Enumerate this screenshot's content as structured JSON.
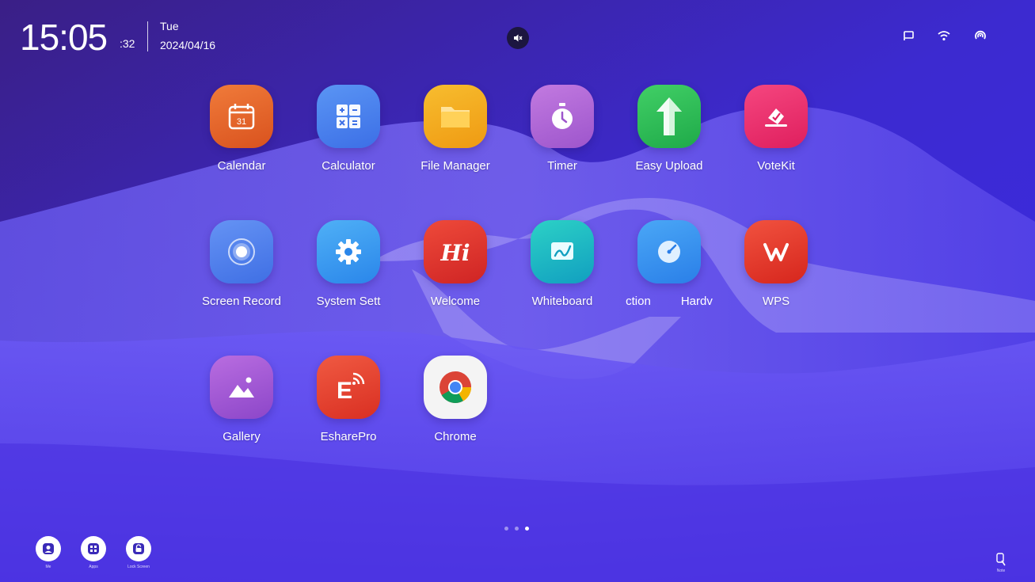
{
  "status_bar": {
    "time": "15:05",
    "seconds": ":32",
    "day": "Tue",
    "date": "2024/04/16",
    "icons": [
      "cast-icon",
      "wifi-icon",
      "hotspot-icon"
    ],
    "mute_icon": "volume-mute-icon"
  },
  "apps": [
    {
      "label": "Calendar",
      "icon": "calendar-icon",
      "color": "#e4642a"
    },
    {
      "label": "Calculator",
      "icon": "calculator-icon",
      "color": "#4a86f0"
    },
    {
      "label": "File Manager",
      "icon": "folder-icon",
      "color": "#f2a51c"
    },
    {
      "label": "Timer",
      "icon": "stopwatch-icon",
      "color": "#b46ad8"
    },
    {
      "label": "Easy Upload",
      "icon": "upload-arrow-icon",
      "color": "#2ebd5a"
    },
    {
      "label": "VoteKit",
      "icon": "vote-icon",
      "color": "#ec2f6e"
    },
    {
      "label": "Screen Record",
      "icon": "record-icon",
      "color": "#4f7ff0"
    },
    {
      "label": "System Sett",
      "icon": "gear-icon",
      "color": "#3b9cf0"
    },
    {
      "label": "Welcome",
      "icon": "hi-icon",
      "color": "#e2352f"
    },
    {
      "label": "Whiteboard",
      "icon": "whiteboard-icon",
      "color": "#14b7c4"
    },
    {
      "label": "ction",
      "label2": "Hardv",
      "icon": "gauge-icon",
      "color": "#2f8fee"
    },
    {
      "label": "WPS",
      "icon": "wps-icon",
      "color": "#e4382e"
    },
    {
      "label": "Gallery",
      "icon": "gallery-icon",
      "color": "#a65ad6"
    },
    {
      "label": "EsharePro",
      "icon": "eshare-icon",
      "color": "#e9483a"
    },
    {
      "label": "Chrome",
      "icon": "chrome-icon",
      "color": "#f4f4f4"
    }
  ],
  "pager": {
    "count": 3,
    "active": 3
  },
  "dock": {
    "buttons": [
      {
        "label": "Me",
        "icon": "user-icon"
      },
      {
        "label": "Apps",
        "icon": "apps-grid-icon"
      },
      {
        "label": "Lock Screen",
        "icon": "lock-icon"
      }
    ],
    "corner": {
      "label": "Note",
      "icon": "annotate-icon"
    }
  }
}
